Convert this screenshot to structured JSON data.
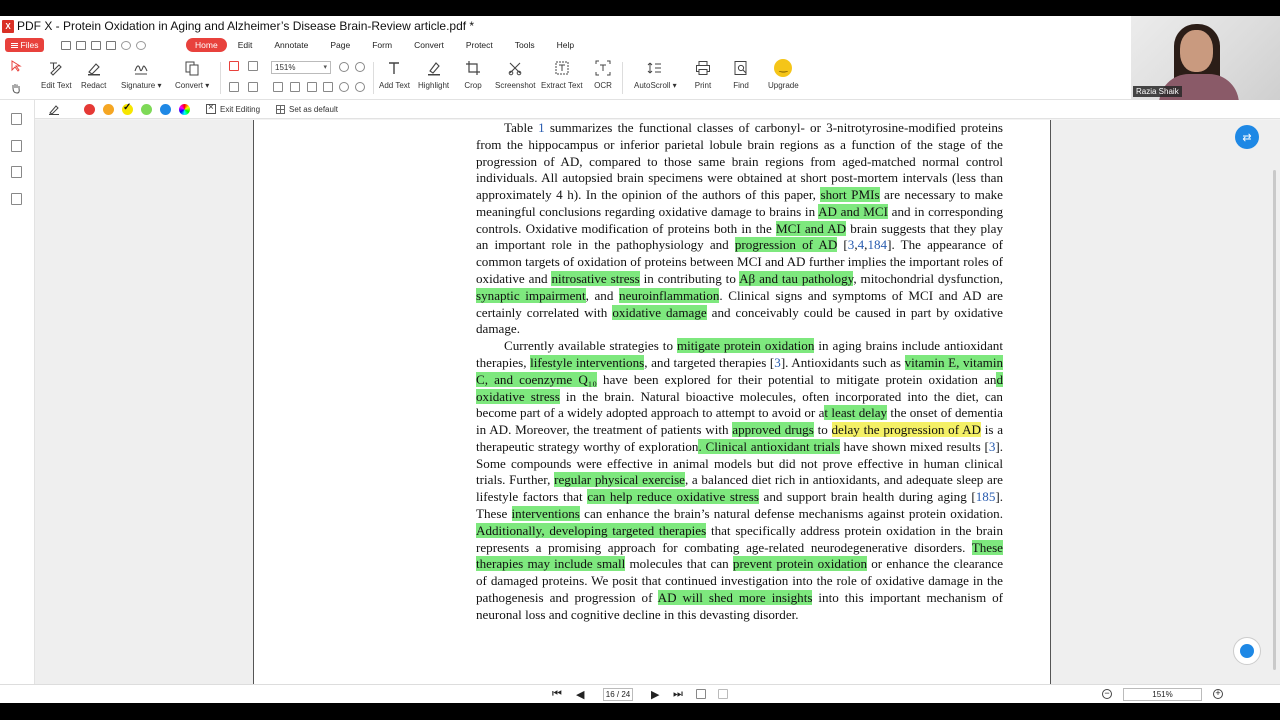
{
  "window": {
    "title": "PDF X - Protein Oxidation in Aging and Alzheimer’s Disease Brain-Review article.pdf *",
    "logo_text": "X"
  },
  "menubar": {
    "files_label": "Files",
    "items": [
      "Home",
      "Edit",
      "Annotate",
      "Page",
      "Form",
      "Convert",
      "Protect",
      "Tools",
      "Help"
    ],
    "active": "Home"
  },
  "toolbar": {
    "edit_text": "Edit Text",
    "redact": "Redact",
    "signature": "Signature ▾",
    "convert": "Convert ▾",
    "zoom_value": "151%",
    "add_text": "Add Text",
    "highlight": "Highlight",
    "crop": "Crop",
    "screenshot": "Screenshot",
    "extract_text": "Extract Text",
    "ocr": "OCR",
    "autoscroll": "AutoScroll ▾",
    "print": "Print",
    "find": "Find",
    "upgrade": "Upgrade"
  },
  "subbar": {
    "colors": [
      "#e53935",
      "#f5a623",
      "#f7e600",
      "#7ed957",
      "#1e88e5"
    ],
    "selected_color_index": 2,
    "exit_editing": "Exit Editing",
    "set_as_default": "Set as default"
  },
  "document": {
    "p1": [
      {
        "t": "Table "
      },
      {
        "t": "1",
        "c": "ref"
      },
      {
        "t": " summarizes the functional classes of carbonyl- or 3-nitrotyrosine-modified proteins from the hippocampus or inferior parietal lobule brain regions as a function of the stage of the progression of AD, compared to those same brain regions from aged-matched normal control individuals.  All autopsied brain specimens were obtained at short post-mortem intervals (less than approximately 4 h). In the opinion of the authors of this paper, "
      },
      {
        "t": "short PMIs",
        "c": "hl"
      },
      {
        "t": " are necessary to make meaningful conclusions regarding oxidative damage to brains in "
      },
      {
        "t": "AD and MCI",
        "c": "hl"
      },
      {
        "t": " and in corresponding controls. Oxidative modification of proteins both in the "
      },
      {
        "t": "MCI and AD",
        "c": "hl"
      },
      {
        "t": " brain suggests that they play an important role in the pathophysiology and "
      },
      {
        "t": "progression of AD",
        "c": "hl"
      },
      {
        "t": " ["
      },
      {
        "t": "3",
        "c": "ref"
      },
      {
        "t": ","
      },
      {
        "t": "4",
        "c": "ref"
      },
      {
        "t": ","
      },
      {
        "t": "184",
        "c": "ref"
      },
      {
        "t": "]. The appearance of common targets of oxidation of proteins between MCI and AD further implies the important roles of oxidative and "
      },
      {
        "t": "nitrosative stress",
        "c": "hl"
      },
      {
        "t": " in contributing to "
      },
      {
        "t": "Aβ and tau pathology",
        "c": "hl"
      },
      {
        "t": ", mitochondrial dysfunction, "
      },
      {
        "t": "synaptic impairment",
        "c": "hl"
      },
      {
        "t": ", and "
      },
      {
        "t": "neuroinflammation",
        "c": "hl"
      },
      {
        "t": ". Clinical signs and symptoms of MCI and AD are certainly correlated with "
      },
      {
        "t": "oxidative damage",
        "c": "hl"
      },
      {
        "t": " and conceivably could be caused in part by oxidative damage."
      }
    ],
    "p2": [
      {
        "t": "Currently available strategies to "
      },
      {
        "t": "mitigate protein oxidation",
        "c": "hl"
      },
      {
        "t": " in aging brains include antioxidant therapies, "
      },
      {
        "t": "lifestyle interventions",
        "c": "hl"
      },
      {
        "t": ", and targeted therapies ["
      },
      {
        "t": "3",
        "c": "ref"
      },
      {
        "t": "].  Antioxidants such as "
      },
      {
        "t": "vitamin E, vitamin C, and coenzyme Q₁₀",
        "c": "hl"
      },
      {
        "t": " have been explored for their potential to mitigate protein oxidation an"
      },
      {
        "t": "d oxidative stress",
        "c": "hl"
      },
      {
        "t": " in the brain. Natural bioactive molecules, often incorporated into the diet, can become part of a widely adopted approach to attempt to avoid or a"
      },
      {
        "t": "t least delay",
        "c": "hl"
      },
      {
        "t": " the onset of dementia in AD. Moreover, the treatment of patients with "
      },
      {
        "t": "approved drugs",
        "c": "hl"
      },
      {
        "t": " to "
      },
      {
        "t": "delay the progression of AD",
        "c": "hly"
      },
      {
        "t": " is a therapeutic strategy worthy of exploration"
      },
      {
        "t": ". Clinical antioxidant trials",
        "c": "hl"
      },
      {
        "t": " have shown mixed results ["
      },
      {
        "t": "3",
        "c": "ref"
      },
      {
        "t": "]. Some compounds were effective in animal models but did not prove effective in human clinical trials. Further, "
      },
      {
        "t": "regular physical exercise",
        "c": "hl"
      },
      {
        "t": ", a balanced diet rich in antioxidants, and adequate sleep are lifestyle factors that "
      },
      {
        "t": "can help reduce oxidative stress",
        "c": "hl"
      },
      {
        "t": " and support brain health during aging ["
      },
      {
        "t": "185",
        "c": "ref"
      },
      {
        "t": "].  These "
      },
      {
        "t": "interventions",
        "c": "hl"
      },
      {
        "t": " can enhance the brain’s natural defense mechanisms against protein oxidation.  "
      },
      {
        "t": "Additionally, developing targeted therapies",
        "c": "hl"
      },
      {
        "t": " that specifically address protein oxidation in the brain represents a promising approach for combating age-related neurodegenerative disorders.  "
      },
      {
        "t": "These therapies may include small",
        "c": "hl"
      },
      {
        "t": " molecules that can "
      },
      {
        "t": "prevent protein oxidation",
        "c": "hl"
      },
      {
        "t": " or enhance the clearance of damaged proteins. We posit that continued investigation into the role of oxidative damage in the pathogenesis and progression of "
      },
      {
        "t": "AD will shed more insights",
        "c": "hl"
      },
      {
        "t": " into this important mechanism of neuronal loss and cognitive decline in this devasting disorder."
      }
    ]
  },
  "statusbar": {
    "page_indicator": "16 / 24",
    "zoom": "151%"
  },
  "webcam": {
    "name": "Razia Shaik"
  }
}
